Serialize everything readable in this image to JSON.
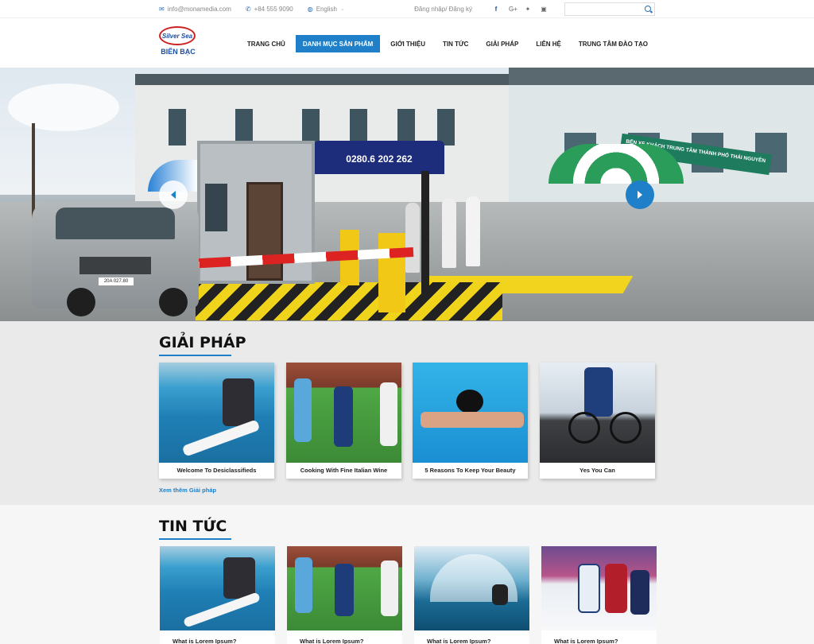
{
  "topbar": {
    "email": "info@monamedia.com",
    "phone": "+84 555 9090",
    "language": "English",
    "login": "Đăng nhập/ Đăng ký",
    "search_placeholder": "",
    "social_icons": [
      "facebook-icon",
      "google-plus-icon",
      "twitter-icon",
      "youtube-icon"
    ]
  },
  "logo": {
    "oval_text": "Silver Sea",
    "name": "BIỂN BẠC"
  },
  "nav": {
    "items": [
      {
        "label": "TRANG CHỦ",
        "active": false
      },
      {
        "label": "DANH MỤC SẢN PHẨM",
        "active": true
      },
      {
        "label": "GIỚI THIỆU",
        "active": false
      },
      {
        "label": "TIN TỨC",
        "active": false
      },
      {
        "label": "GIẢI PHÁP",
        "active": false
      },
      {
        "label": "LIÊN HỆ",
        "active": false
      },
      {
        "label": "TRUNG TÂM ĐÀO TẠO",
        "active": false
      }
    ]
  },
  "hero": {
    "station_sign": "BẾN XE KHÁCH TRUNG TÂM THÀNH PHỐ THÁI NGUYÊN",
    "umbrella_text": "0280.6 202 262",
    "plate": "20A 027.80"
  },
  "solutions": {
    "title": "GIẢI PHÁP",
    "cards": [
      {
        "caption": "Welcome To Desiclassifieds",
        "image": "surfing"
      },
      {
        "caption": "Cooking With Fine Italian Wine",
        "image": "field-hockey"
      },
      {
        "caption": "5 Reasons To Keep Your Beauty",
        "image": "swimming"
      },
      {
        "caption": "Yes You Can",
        "image": "cycling"
      }
    ],
    "more_link": "Xem thêm Giải pháp"
  },
  "news": {
    "title": "TIN TỨC",
    "cards": [
      {
        "caption": "What is Lorem Ipsum?",
        "image": "surfing"
      },
      {
        "caption": "What is Lorem Ipsum?",
        "image": "field-hockey"
      },
      {
        "caption": "What is Lorem Ipsum?",
        "image": "motorcycle-wave"
      },
      {
        "caption": "What is Lorem Ipsum?",
        "image": "ice-hockey"
      }
    ]
  },
  "colors": {
    "accent": "#1f7fc9",
    "section_bg": "#eaeaea"
  }
}
